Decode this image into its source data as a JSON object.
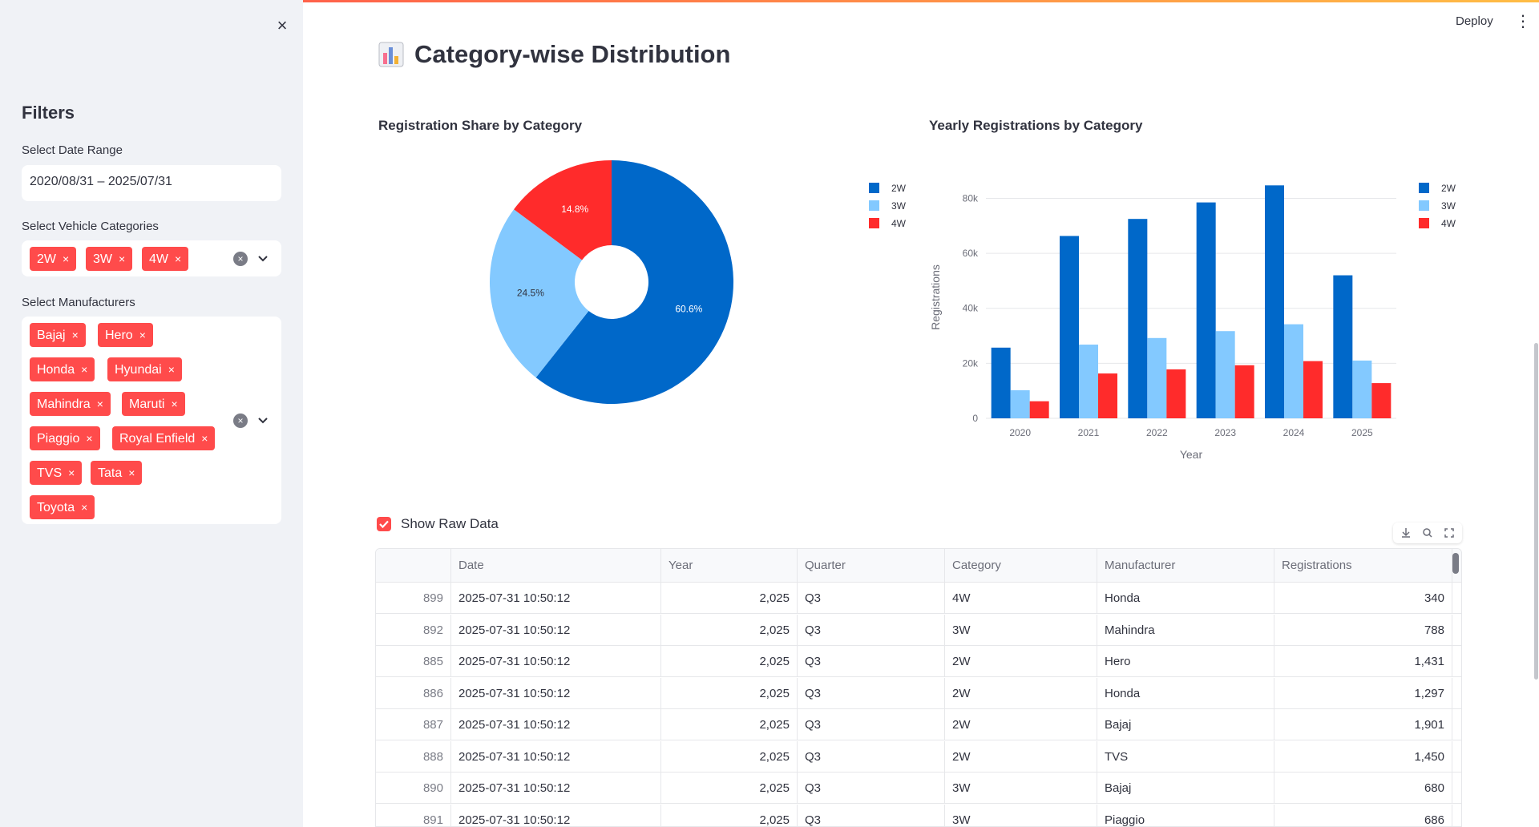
{
  "sidebar": {
    "close_label": "×",
    "filters_title": "Filters",
    "date_label": "Select Date Range",
    "date_value": "2020/08/31 – 2025/07/31",
    "categories_label": "Select Vehicle Categories",
    "categories": [
      "2W",
      "3W",
      "4W"
    ],
    "manufacturers_label": "Select Manufacturers",
    "manufacturers": [
      "Bajaj",
      "Hero",
      "Honda",
      "Hyundai",
      "Mahindra",
      "Maruti",
      "Piaggio",
      "Royal Enfield",
      "TVS",
      "Tata",
      "Toyota"
    ],
    "chip_remove": "×",
    "clear_icon": "×"
  },
  "header": {
    "deploy_label": "Deploy",
    "menu_icon": "⋮"
  },
  "main": {
    "page_icon": "bar-chart-icon",
    "title": "Category-wise Distribution",
    "show_raw_label": "Show Raw Data",
    "show_raw_checked": true
  },
  "colors": {
    "2W": "#0068c9",
    "3W": "#83c9ff",
    "4W": "#ff2b2b",
    "accent": "#ff4b4b"
  },
  "chart_data": [
    {
      "type": "pie",
      "title": "Registration Share by Category",
      "hole": true,
      "labels": [
        "2W",
        "3W",
        "4W"
      ],
      "values": [
        60.6,
        24.5,
        14.8
      ],
      "value_labels": [
        "60.6%",
        "24.5%",
        "14.8%"
      ],
      "legend": [
        "2W",
        "3W",
        "4W"
      ],
      "legend_position": "right"
    },
    {
      "type": "bar",
      "title": "Yearly Registrations by Category",
      "xlabel": "Year",
      "ylabel": "Registrations",
      "categories": [
        "2020",
        "2021",
        "2022",
        "2023",
        "2024",
        "2025"
      ],
      "ylim": [
        0,
        88000
      ],
      "yticks": [
        0,
        20000,
        40000,
        60000,
        80000
      ],
      "ytick_labels": [
        "0",
        "20k",
        "40k",
        "60k",
        "80k"
      ],
      "series": [
        {
          "name": "2W",
          "values": [
            25700,
            66300,
            72500,
            78500,
            84700,
            52000
          ]
        },
        {
          "name": "3W",
          "values": [
            10200,
            26800,
            29200,
            31700,
            34200,
            21000
          ]
        },
        {
          "name": "4W",
          "values": [
            6200,
            16300,
            17800,
            19300,
            20800,
            12800
          ]
        }
      ],
      "legend_position": "top-right"
    }
  ],
  "table": {
    "columns": [
      "",
      "Date",
      "Year",
      "Quarter",
      "Category",
      "Manufacturer",
      "Registrations"
    ],
    "rows": [
      [
        "899",
        "2025-07-31 10:50:12",
        "2,025",
        "Q3",
        "4W",
        "Honda",
        "340"
      ],
      [
        "892",
        "2025-07-31 10:50:12",
        "2,025",
        "Q3",
        "3W",
        "Mahindra",
        "788"
      ],
      [
        "885",
        "2025-07-31 10:50:12",
        "2,025",
        "Q3",
        "2W",
        "Hero",
        "1,431"
      ],
      [
        "886",
        "2025-07-31 10:50:12",
        "2,025",
        "Q3",
        "2W",
        "Honda",
        "1,297"
      ],
      [
        "887",
        "2025-07-31 10:50:12",
        "2,025",
        "Q3",
        "2W",
        "Bajaj",
        "1,901"
      ],
      [
        "888",
        "2025-07-31 10:50:12",
        "2,025",
        "Q3",
        "2W",
        "TVS",
        "1,450"
      ],
      [
        "890",
        "2025-07-31 10:50:12",
        "2,025",
        "Q3",
        "3W",
        "Bajaj",
        "680"
      ],
      [
        "891",
        "2025-07-31 10:50:12",
        "2,025",
        "Q3",
        "3W",
        "Piaggio",
        "686"
      ]
    ],
    "toolbar_icons": [
      "download-icon",
      "search-icon",
      "fullscreen-icon"
    ]
  }
}
